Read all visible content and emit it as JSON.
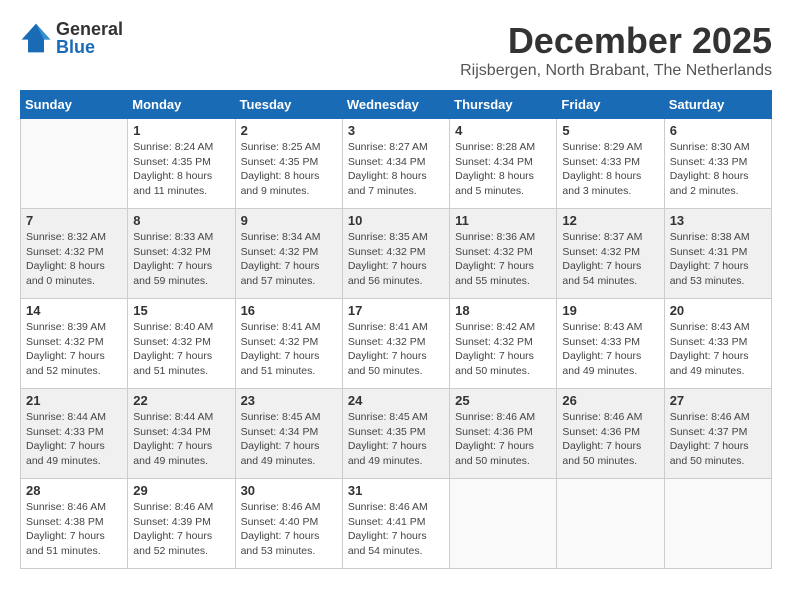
{
  "logo": {
    "line1": "General",
    "line2": "Blue"
  },
  "title": "December 2025",
  "subtitle": "Rijsbergen, North Brabant, The Netherlands",
  "headers": [
    "Sunday",
    "Monday",
    "Tuesday",
    "Wednesday",
    "Thursday",
    "Friday",
    "Saturday"
  ],
  "weeks": [
    [
      {
        "day": "",
        "info": ""
      },
      {
        "day": "1",
        "info": "Sunrise: 8:24 AM\nSunset: 4:35 PM\nDaylight: 8 hours\nand 11 minutes."
      },
      {
        "day": "2",
        "info": "Sunrise: 8:25 AM\nSunset: 4:35 PM\nDaylight: 8 hours\nand 9 minutes."
      },
      {
        "day": "3",
        "info": "Sunrise: 8:27 AM\nSunset: 4:34 PM\nDaylight: 8 hours\nand 7 minutes."
      },
      {
        "day": "4",
        "info": "Sunrise: 8:28 AM\nSunset: 4:34 PM\nDaylight: 8 hours\nand 5 minutes."
      },
      {
        "day": "5",
        "info": "Sunrise: 8:29 AM\nSunset: 4:33 PM\nDaylight: 8 hours\nand 3 minutes."
      },
      {
        "day": "6",
        "info": "Sunrise: 8:30 AM\nSunset: 4:33 PM\nDaylight: 8 hours\nand 2 minutes."
      }
    ],
    [
      {
        "day": "7",
        "info": "Sunrise: 8:32 AM\nSunset: 4:32 PM\nDaylight: 8 hours\nand 0 minutes."
      },
      {
        "day": "8",
        "info": "Sunrise: 8:33 AM\nSunset: 4:32 PM\nDaylight: 7 hours\nand 59 minutes."
      },
      {
        "day": "9",
        "info": "Sunrise: 8:34 AM\nSunset: 4:32 PM\nDaylight: 7 hours\nand 57 minutes."
      },
      {
        "day": "10",
        "info": "Sunrise: 8:35 AM\nSunset: 4:32 PM\nDaylight: 7 hours\nand 56 minutes."
      },
      {
        "day": "11",
        "info": "Sunrise: 8:36 AM\nSunset: 4:32 PM\nDaylight: 7 hours\nand 55 minutes."
      },
      {
        "day": "12",
        "info": "Sunrise: 8:37 AM\nSunset: 4:32 PM\nDaylight: 7 hours\nand 54 minutes."
      },
      {
        "day": "13",
        "info": "Sunrise: 8:38 AM\nSunset: 4:31 PM\nDaylight: 7 hours\nand 53 minutes."
      }
    ],
    [
      {
        "day": "14",
        "info": "Sunrise: 8:39 AM\nSunset: 4:32 PM\nDaylight: 7 hours\nand 52 minutes."
      },
      {
        "day": "15",
        "info": "Sunrise: 8:40 AM\nSunset: 4:32 PM\nDaylight: 7 hours\nand 51 minutes."
      },
      {
        "day": "16",
        "info": "Sunrise: 8:41 AM\nSunset: 4:32 PM\nDaylight: 7 hours\nand 51 minutes."
      },
      {
        "day": "17",
        "info": "Sunrise: 8:41 AM\nSunset: 4:32 PM\nDaylight: 7 hours\nand 50 minutes."
      },
      {
        "day": "18",
        "info": "Sunrise: 8:42 AM\nSunset: 4:32 PM\nDaylight: 7 hours\nand 50 minutes."
      },
      {
        "day": "19",
        "info": "Sunrise: 8:43 AM\nSunset: 4:33 PM\nDaylight: 7 hours\nand 49 minutes."
      },
      {
        "day": "20",
        "info": "Sunrise: 8:43 AM\nSunset: 4:33 PM\nDaylight: 7 hours\nand 49 minutes."
      }
    ],
    [
      {
        "day": "21",
        "info": "Sunrise: 8:44 AM\nSunset: 4:33 PM\nDaylight: 7 hours\nand 49 minutes."
      },
      {
        "day": "22",
        "info": "Sunrise: 8:44 AM\nSunset: 4:34 PM\nDaylight: 7 hours\nand 49 minutes."
      },
      {
        "day": "23",
        "info": "Sunrise: 8:45 AM\nSunset: 4:34 PM\nDaylight: 7 hours\nand 49 minutes."
      },
      {
        "day": "24",
        "info": "Sunrise: 8:45 AM\nSunset: 4:35 PM\nDaylight: 7 hours\nand 49 minutes."
      },
      {
        "day": "25",
        "info": "Sunrise: 8:46 AM\nSunset: 4:36 PM\nDaylight: 7 hours\nand 50 minutes."
      },
      {
        "day": "26",
        "info": "Sunrise: 8:46 AM\nSunset: 4:36 PM\nDaylight: 7 hours\nand 50 minutes."
      },
      {
        "day": "27",
        "info": "Sunrise: 8:46 AM\nSunset: 4:37 PM\nDaylight: 7 hours\nand 50 minutes."
      }
    ],
    [
      {
        "day": "28",
        "info": "Sunrise: 8:46 AM\nSunset: 4:38 PM\nDaylight: 7 hours\nand 51 minutes."
      },
      {
        "day": "29",
        "info": "Sunrise: 8:46 AM\nSunset: 4:39 PM\nDaylight: 7 hours\nand 52 minutes."
      },
      {
        "day": "30",
        "info": "Sunrise: 8:46 AM\nSunset: 4:40 PM\nDaylight: 7 hours\nand 53 minutes."
      },
      {
        "day": "31",
        "info": "Sunrise: 8:46 AM\nSunset: 4:41 PM\nDaylight: 7 hours\nand 54 minutes."
      },
      {
        "day": "",
        "info": ""
      },
      {
        "day": "",
        "info": ""
      },
      {
        "day": "",
        "info": ""
      }
    ]
  ]
}
